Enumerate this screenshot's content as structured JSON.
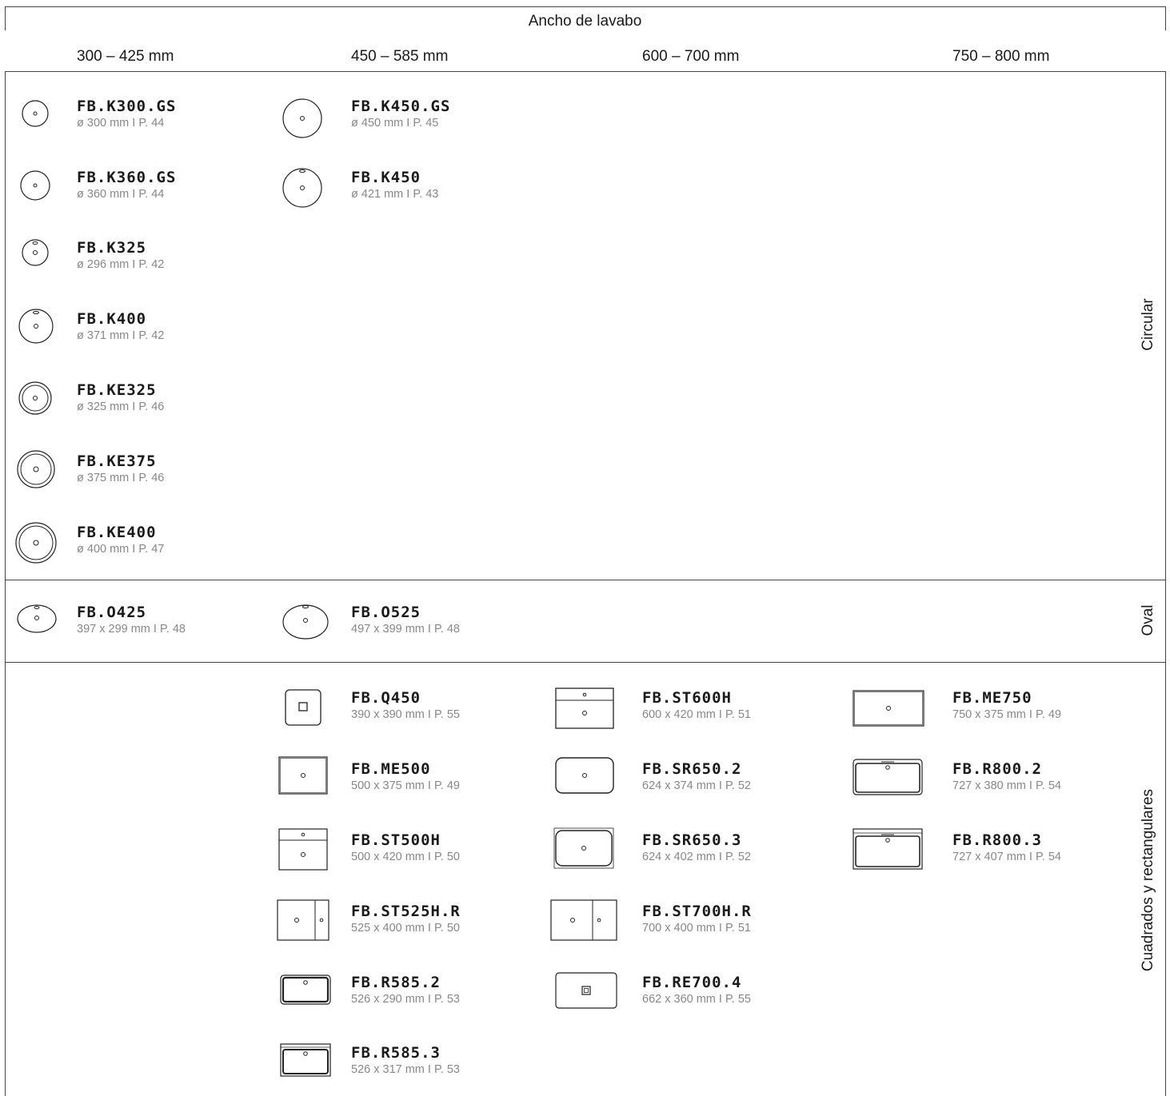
{
  "title": "Ancho de lavabo",
  "columns": [
    "300 – 425 mm",
    "450 – 585 mm",
    "600 – 700 mm",
    "750 – 800 mm"
  ],
  "sections": [
    "Circular",
    "Oval",
    "Cuadrados y rectangulares"
  ],
  "items": [
    {
      "code": "FB.K300.GS",
      "spec": "ø 300 mm I P. 44",
      "icon": "round-basin-icon"
    },
    {
      "code": "FB.K360.GS",
      "spec": "ø 360 mm I P. 44",
      "icon": "round-basin-icon"
    },
    {
      "code": "FB.K325",
      "spec": "ø 296 mm I P. 42",
      "icon": "round-basin-overflow-icon"
    },
    {
      "code": "FB.K400",
      "spec": "ø 371 mm I P. 42",
      "icon": "round-basin-overflow-icon"
    },
    {
      "code": "FB.KE325",
      "spec": "ø 325 mm I P. 46",
      "icon": "round-basin-rim-icon"
    },
    {
      "code": "FB.KE375",
      "spec": "ø 375 mm I P. 46",
      "icon": "round-basin-rim-icon"
    },
    {
      "code": "FB.KE400",
      "spec": "ø 400 mm I P. 47",
      "icon": "round-basin-rim-icon"
    },
    {
      "code": "FB.K450.GS",
      "spec": "ø 450 mm I P. 45",
      "icon": "round-basin-icon"
    },
    {
      "code": "FB.K450",
      "spec": "ø 421 mm I P. 43",
      "icon": "round-basin-overflow-icon"
    },
    {
      "code": "FB.O425",
      "spec": "397 x 299 mm I P. 48",
      "icon": "oval-basin-icon"
    },
    {
      "code": "FB.O525",
      "spec": "497 x 399 mm I P. 48",
      "icon": "oval-basin-icon"
    },
    {
      "code": "FB.Q450",
      "spec": "390 x 390 mm I P. 55",
      "icon": "square-basin-icon"
    },
    {
      "code": "FB.ME500",
      "spec": "500 x 375 mm I P. 49",
      "icon": "rect-basin-icon"
    },
    {
      "code": "FB.ST500H",
      "spec": "500 x 420 mm I P. 50",
      "icon": "rect-basin-shelf-icon"
    },
    {
      "code": "FB.ST525H.R",
      "spec": "525 x 400 mm I P. 50",
      "icon": "rect-basin-side-shelf-icon"
    },
    {
      "code": "FB.R585.2",
      "spec": "526 x 290 mm I P. 53",
      "icon": "rect-basin-rounded-icon"
    },
    {
      "code": "FB.R585.3",
      "spec": "526 x 317 mm I P. 53",
      "icon": "rect-basin-rounded-icon"
    },
    {
      "code": "FB.ST600H",
      "spec": "600 x 420 mm I P. 51",
      "icon": "rect-basin-shelf-icon"
    },
    {
      "code": "FB.SR650.2",
      "spec": "624 x 374 mm I P. 52",
      "icon": "rect-basin-soft-icon"
    },
    {
      "code": "FB.SR650.3",
      "spec": "624 x 402 mm I P. 52",
      "icon": "rect-basin-soft-icon"
    },
    {
      "code": "FB.ST700H.R",
      "spec": "700 x 400 mm I P. 51",
      "icon": "rect-basin-side-shelf-icon"
    },
    {
      "code": "FB.RE700.4",
      "spec": "662 x 360 mm I P. 55",
      "icon": "rect-basin-square-drain-icon"
    },
    {
      "code": "FB.ME750",
      "spec": "750 x 375 mm I P. 49",
      "icon": "rect-basin-icon"
    },
    {
      "code": "FB.R800.2",
      "spec": "727 x 380 mm I P. 54",
      "icon": "rect-basin-rounded-icon"
    },
    {
      "code": "FB.R800.3",
      "spec": "727 x 407 mm I P. 54",
      "icon": "rect-basin-rounded-icon"
    }
  ]
}
